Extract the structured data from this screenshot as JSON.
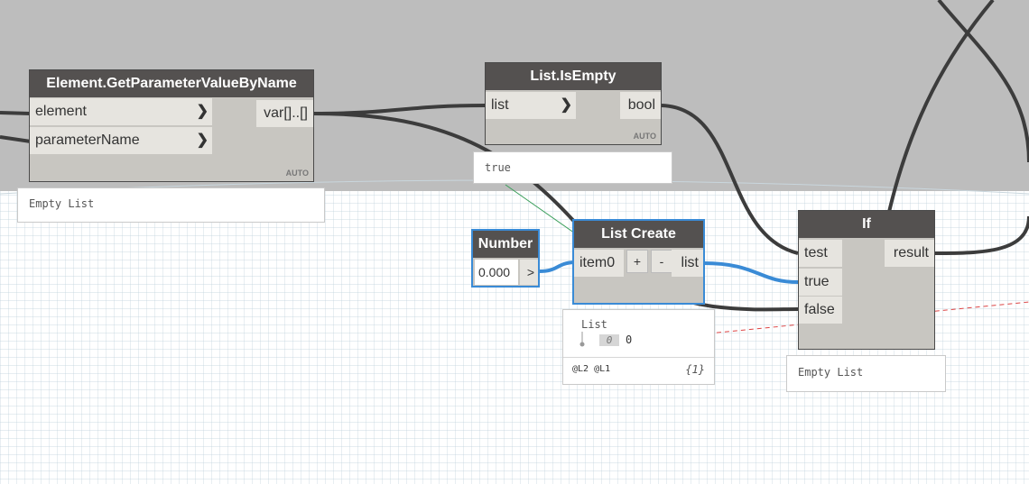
{
  "nodes": {
    "get_param": {
      "title": "Element.GetParameterValueByName",
      "inputs": [
        "element",
        "parameterName"
      ],
      "output": "var[]..[]",
      "lacing": "AUTO",
      "preview": "Empty List"
    },
    "is_empty": {
      "title": "List.IsEmpty",
      "input": "list",
      "output": "bool",
      "lacing": "AUTO",
      "preview": "true"
    },
    "number": {
      "title": "Number",
      "value": "0.000",
      "output_symbol": ">"
    },
    "list_create": {
      "title": "List Create",
      "input": "item0",
      "add_symbol": "+",
      "remove_symbol": "-",
      "output": "list",
      "preview": {
        "header": "List",
        "index": "0",
        "value": "0",
        "levels": "@L2 @L1",
        "count": "{1}"
      }
    },
    "if": {
      "title": "If",
      "inputs": [
        "test",
        "true",
        "false"
      ],
      "output": "result",
      "preview": "Empty List"
    }
  },
  "colors": {
    "background_top": "#bdbdbd",
    "node_header": "#545150",
    "node_body": "#c8c6c1",
    "wire": "#3c3c3c",
    "selected": "#3a8bd6"
  }
}
